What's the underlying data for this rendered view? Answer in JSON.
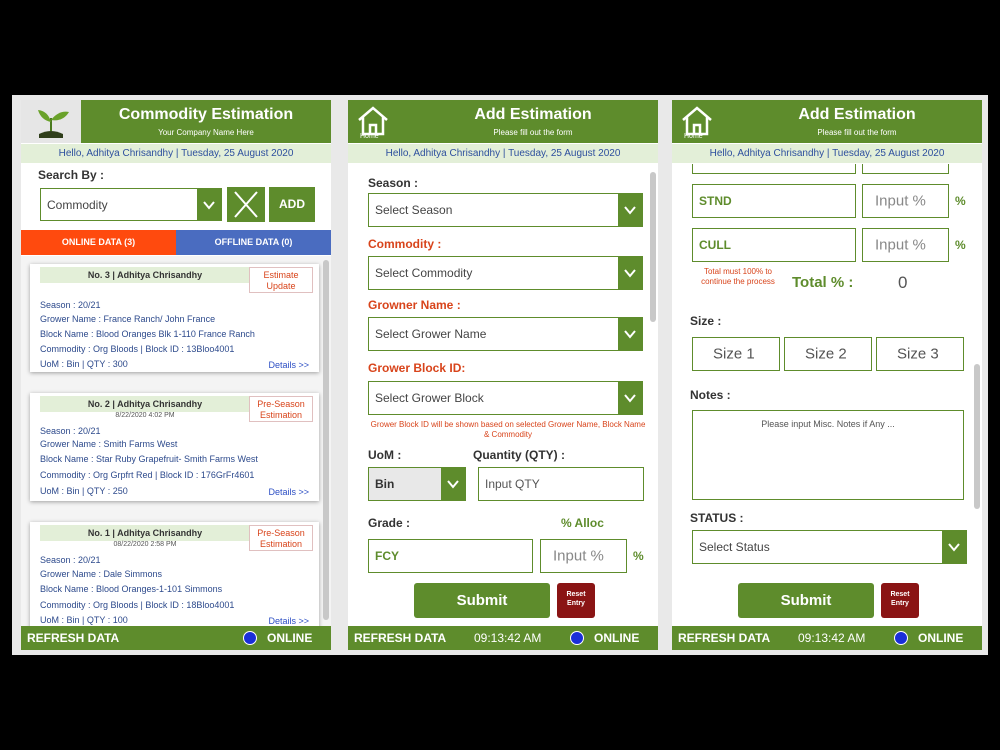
{
  "panel1": {
    "title": "Commodity Estimation",
    "subtitle": "Your Company Name Here",
    "hello": "Hello, Adhitya Chrisandhy | Tuesday, 25 August 2020",
    "search_label": "Search By :",
    "search_value": "Commodity",
    "add_label": "ADD",
    "tab_online": "ONLINE DATA (3)",
    "tab_offline": "OFFLINE DATA (0)",
    "cards": [
      {
        "title": "No. 3 | Adhitya Chrisandhy",
        "timestamp": "",
        "tag": "Estimate Update",
        "season": "Season : 20/21",
        "grower": "Grower Name : France Ranch/ John France",
        "block": "Block Name : Blood Oranges Blk 1-110 France Ranch",
        "commodity": "Commodity : Org Bloods | Block ID : 13Bloo4001",
        "uom": "UoM : Bin | QTY : 300",
        "details": "Details >>"
      },
      {
        "title": "No. 2 | Adhitya Chrisandhy",
        "timestamp": "8/22/2020 4:02 PM",
        "tag": "Pre-Season Estimation",
        "season": "Season : 20/21",
        "grower": "Grower Name : Smith Farms West",
        "block": "Block Name : Star Ruby Grapefruit- Smith Farms West",
        "commodity": "Commodity : Org Grpfrt Red | Block ID : 176GrFr4601",
        "uom": "UoM : Bin | QTY : 250",
        "details": "Details >>"
      },
      {
        "title": "No. 1 | Adhitya Chrisandhy",
        "timestamp": "08/22/2020 2:58 PM",
        "tag": "Pre-Season Estimation",
        "season": "Season : 20/21",
        "grower": "Grower Name : Dale Simmons",
        "block": "Block Name : Blood Oranges-1-101 Simmons",
        "commodity": "Commodity : Org Bloods | Block ID : 18Bloo4001",
        "uom": "UoM : Bin | QTY : 100",
        "details": "Details >>"
      }
    ],
    "footer_refresh": "REFRESH DATA",
    "footer_status": "ONLINE"
  },
  "panel2": {
    "title": "Add Estimation",
    "subtitle": "Please fill out the form",
    "home": "Home",
    "hello": "Hello, Adhitya Chrisandhy | Tuesday, 25 August 2020",
    "season_label": "Season :",
    "season_placeholder": "Select Season",
    "commodity_label": "Commodity :",
    "commodity_placeholder": "Select Commodity",
    "grower_label": "Growner Name :",
    "grower_placeholder": "Select Grower Name",
    "block_label": "Grower Block ID:",
    "block_placeholder": "Select Grower Block",
    "block_note": "Grower Block ID will be shown based on selected Grower Name, Block Name & Commodity",
    "uom_label": "UoM :",
    "uom_value": "Bin",
    "qty_label": "Quantity (QTY) :",
    "qty_placeholder": "Input QTY",
    "grade_label": "Grade :",
    "alloc_label": "% Alloc",
    "grade_value": "FCY",
    "alloc_placeholder": "Input %",
    "pct": "%",
    "submit": "Submit",
    "reset": "Reset Entry",
    "footer_refresh": "REFRESH DATA",
    "footer_time": "09:13:42 AM",
    "footer_status": "ONLINE"
  },
  "panel3": {
    "title": "Add Estimation",
    "subtitle": "Please fill out the form",
    "home": "Home",
    "hello": "Hello, Adhitya Chrisandhy | Tuesday, 25 August 2020",
    "stnd": "STND",
    "cull": "CULL",
    "input_pct": "Input %",
    "pct": "%",
    "total_note": "Total must 100% to continue the process",
    "total_label": "Total % :",
    "total_value": "0",
    "size_label": "Size :",
    "size1": "Size 1",
    "size2": "Size 2",
    "size3": "Size 3",
    "notes_label": "Notes :",
    "notes_placeholder": "Please input Misc. Notes if Any ...",
    "status_label": "STATUS :",
    "status_placeholder": "Select Status",
    "submit": "Submit",
    "reset": "Reset Entry",
    "footer_refresh": "REFRESH DATA",
    "footer_time": "09:13:42 AM",
    "footer_status": "ONLINE"
  },
  "colors": {
    "primary_green": "#5e8c2c",
    "accent_orange": "#ff4a0e",
    "accent_blue": "#4a6cc0",
    "reset_red": "#8a1414"
  }
}
